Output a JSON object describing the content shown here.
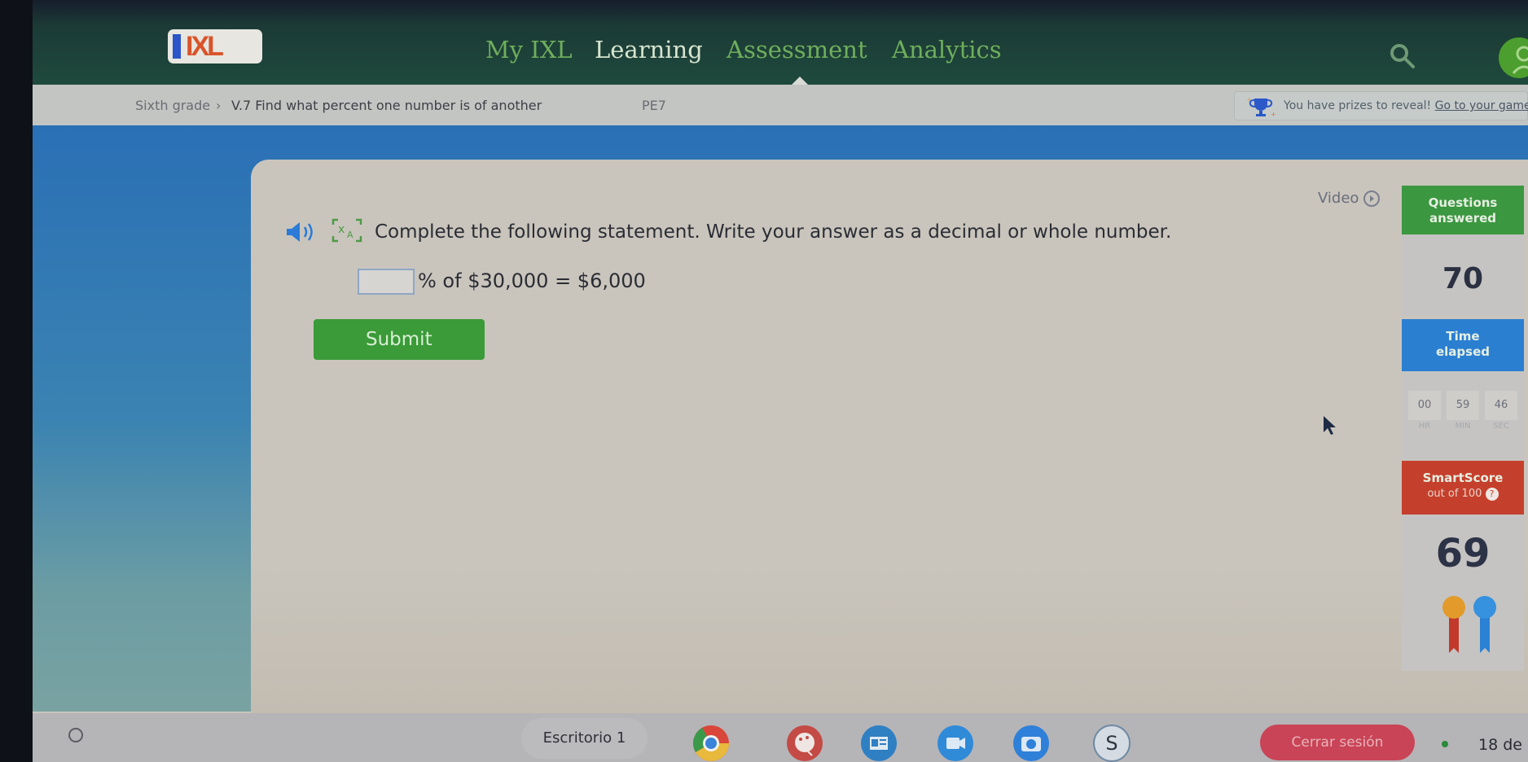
{
  "app": {
    "logo_text": "IXL",
    "brand_colors": {
      "logo_blue": "#2b55c8",
      "logo_orange": "#d9542a",
      "nav_bg": "#1e4a3c",
      "nav_text": "#6fae5c"
    }
  },
  "nav": {
    "items": [
      {
        "label": "My IXL",
        "active": false
      },
      {
        "label": "Learning",
        "active": true
      },
      {
        "label": "Assessment",
        "active": false
      },
      {
        "label": "Analytics",
        "active": false
      }
    ],
    "search_icon": "search-icon",
    "avatar_icon": "user-avatar-icon"
  },
  "breadcrumb": {
    "grade": "Sixth grade",
    "separator": "›",
    "skill": "V.7 Find what percent one number is of another",
    "skill_code": "PE7"
  },
  "prize_banner": {
    "icon": "trophy-icon",
    "text": "You have prizes to reveal!",
    "link": "Go to your game board"
  },
  "question": {
    "instruction": "Complete the following statement. Write your answer as a decimal or whole number.",
    "answer_value": "",
    "answer_placeholder": "",
    "equation": "% of $30,000 = $6,000",
    "submit_label": "Submit",
    "video_label": "Video"
  },
  "stats": {
    "questions_answered": {
      "label_line1": "Questions",
      "label_line2": "answered",
      "value": "70",
      "color": "#3b9740"
    },
    "time_elapsed": {
      "label_line1": "Time",
      "label_line2": "elapsed",
      "color": "#2a7fd1",
      "hours": "00",
      "minutes": "59",
      "seconds": "46",
      "hours_label": "HR",
      "minutes_label": "MIN",
      "seconds_label": "SEC"
    },
    "smartscore": {
      "label_line1": "SmartScore",
      "label_line2": "out of 100",
      "info_icon": "?",
      "value": "69",
      "color": "#c5402c"
    }
  },
  "taskbar": {
    "desk_label": "Escritorio 1",
    "apps": [
      "chrome-icon",
      "paint-icon",
      "slides-icon",
      "video-call-icon",
      "camera-icon",
      "s-app-icon"
    ],
    "s_app_letter": "S",
    "logout_label": "Cerrar sesión",
    "date": "18 de"
  }
}
